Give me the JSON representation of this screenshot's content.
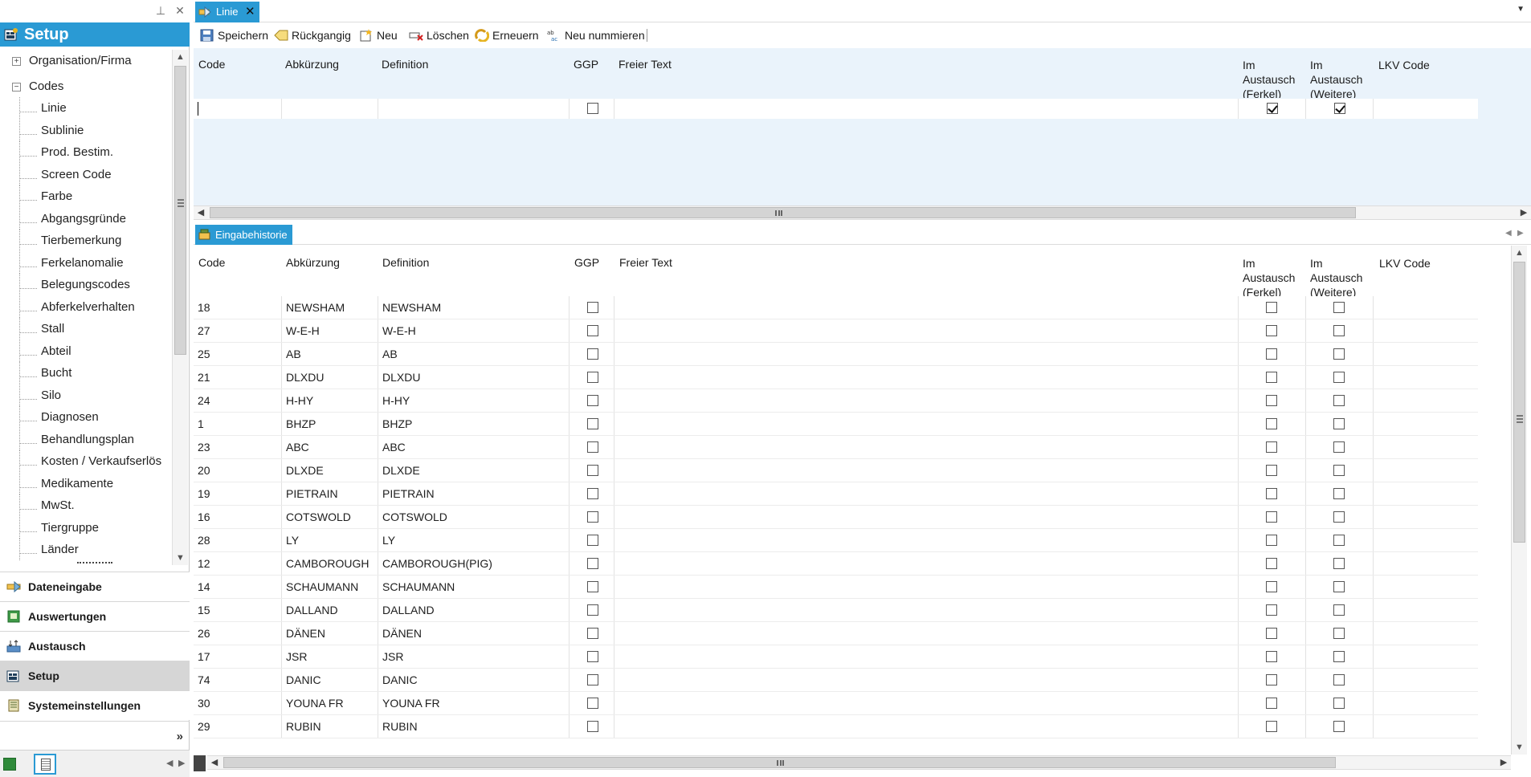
{
  "left_panel": {
    "header_title": "Setup",
    "tree": {
      "org": "Organisation/Firma",
      "codes": "Codes",
      "leaves": [
        "Linie",
        "Sublinie",
        "Prod. Bestim.",
        "Screen Code",
        "Farbe",
        "Abgangsgründe",
        "Tierbemerkung",
        "Ferkelanomalie",
        "Belegungscodes",
        "Abferkelverhalten",
        "Stall",
        "Abteil",
        "Bucht",
        "Silo",
        "Diagnosen",
        "Behandlungsplan",
        "Kosten / Verkaufserlös",
        "Medikamente",
        "MwSt.",
        "Tiergruppe",
        "Länder"
      ]
    },
    "sections": [
      "Dateneingabe",
      "Auswertungen",
      "Austausch",
      "Setup",
      "Systemeinstellungen"
    ],
    "overflow_glyph": "»"
  },
  "doc_tab": {
    "label": "Linie",
    "close": "✕"
  },
  "toolbar": {
    "save": "Speichern",
    "undo": "Rückgangig",
    "new": "Neu",
    "delete": "Löschen",
    "refresh": "Erneuern",
    "renumber": "Neu nummieren"
  },
  "columns": {
    "code": "Code",
    "abk": "Abkürzung",
    "def": "Definition",
    "ggp": "GGP",
    "freier": "Freier Text",
    "ferkel": "Im Austausch (Ferkel)",
    "weitere": "Im Austausch (Weitere)",
    "lkv": "LKV Code"
  },
  "entry_row": {
    "ggp": false,
    "ferkel": true,
    "weitere": true
  },
  "history_tab": {
    "label": "Eingabehistorie"
  },
  "history_rows": [
    {
      "code": "18",
      "abk": "NEWSHAM",
      "def": "NEWSHAM"
    },
    {
      "code": "27",
      "abk": "W-E-H",
      "def": "W-E-H"
    },
    {
      "code": "25",
      "abk": "AB",
      "def": "AB"
    },
    {
      "code": "21",
      "abk": "DLXDU",
      "def": "DLXDU"
    },
    {
      "code": "24",
      "abk": "H-HY",
      "def": "H-HY"
    },
    {
      "code": "1",
      "abk": "BHZP",
      "def": "BHZP"
    },
    {
      "code": "23",
      "abk": "ABC",
      "def": "ABC"
    },
    {
      "code": "20",
      "abk": "DLXDE",
      "def": "DLXDE"
    },
    {
      "code": "19",
      "abk": "PIETRAIN",
      "def": "PIETRAIN"
    },
    {
      "code": "16",
      "abk": "COTSWOLD",
      "def": "COTSWOLD"
    },
    {
      "code": "28",
      "abk": "LY",
      "def": "LY"
    },
    {
      "code": "12",
      "abk": "CAMBOROUGH",
      "def": "CAMBOROUGH(PIG)"
    },
    {
      "code": "14",
      "abk": "SCHAUMANN",
      "def": "SCHAUMANN"
    },
    {
      "code": "15",
      "abk": "DALLAND",
      "def": "DALLAND"
    },
    {
      "code": "26",
      "abk": "DÄNEN",
      "def": "DÄNEN"
    },
    {
      "code": "17",
      "abk": "JSR",
      "def": "JSR"
    },
    {
      "code": "74",
      "abk": "DANIC",
      "def": "DANIC"
    },
    {
      "code": "30",
      "abk": "YOUNA FR",
      "def": "YOUNA FR"
    },
    {
      "code": "29",
      "abk": "RUBIN",
      "def": "RUBIN"
    }
  ],
  "colors": {
    "accent": "#2a9ad4",
    "entry_bg": "#eaf3fb",
    "active_section": "#d6d6d6"
  }
}
